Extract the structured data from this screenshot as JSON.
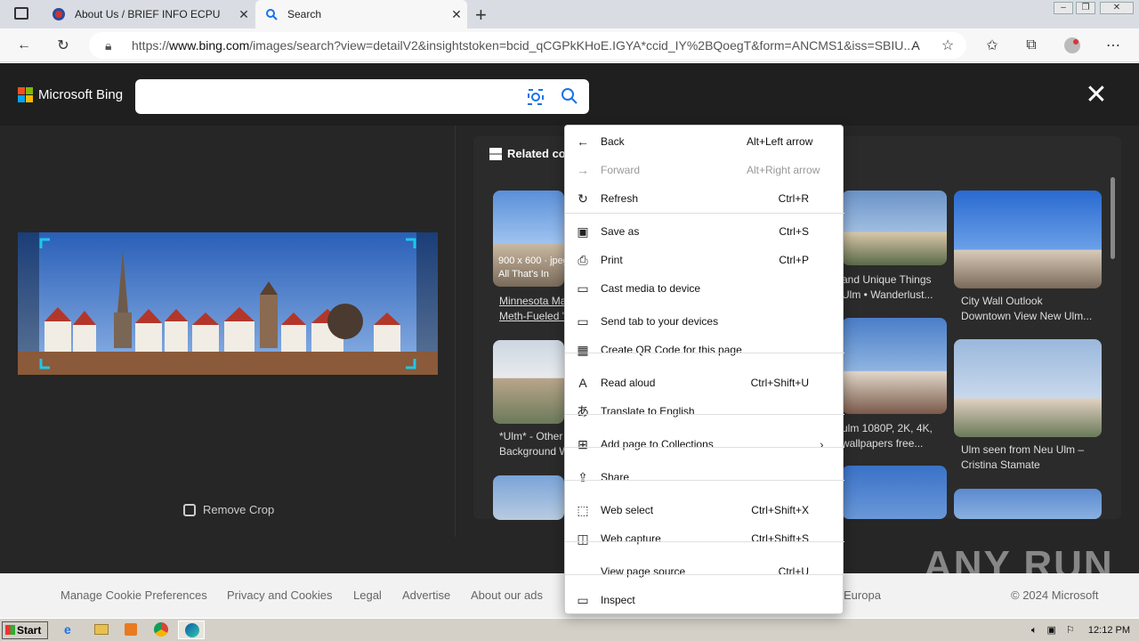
{
  "tabs": [
    {
      "title": "About Us / BRIEF INFO ECPU"
    },
    {
      "title": "Search"
    }
  ],
  "address": {
    "prefix": "https://",
    "host": "www.bing.com",
    "path": "/images/search?view=detailV2&insightstoken=bcid_qCGPkKHoE.IGYA*ccid_IY%2BQoegT&form=ANCMS1&iss=SBIU..."
  },
  "bing": {
    "brand": "Microsoft Bing",
    "remove_crop": "Remove Crop",
    "related": "Related co"
  },
  "results": [
    {
      "caption": "Minnesota Ma\nMeth-Fueled '"
    },
    {
      "caption": "and Unique Things\nUlm • Wanderlust..."
    },
    {
      "caption": "City Wall Outlook\nDowntown View New Ulm..."
    },
    {
      "caption": "*Ulm* - Other\nBackground W"
    },
    {
      "caption": "ulm 1080P, 2K, 4K,\nwallpapers free..."
    },
    {
      "caption": "Ulm seen from Neu Ulm –\nCristina Stamate"
    }
  ],
  "thumb_overlay": "900 x 600 · jpeg\nAll That's In",
  "footer": {
    "items": [
      "Manage Cookie Preferences",
      "Privacy and Cookies",
      "Legal",
      "Advertise",
      "About our ads",
      "Europa",
      "© 2024 Microsoft"
    ]
  },
  "menu": {
    "items": [
      {
        "label": "Back",
        "shortcut": "Alt+Left arrow",
        "icon": "back-arrow-icon",
        "disabled": false
      },
      {
        "label": "Forward",
        "shortcut": "Alt+Right arrow",
        "icon": "forward-arrow-icon",
        "disabled": true
      },
      {
        "label": "Refresh",
        "shortcut": "Ctrl+R",
        "icon": "refresh-icon",
        "disabled": false
      },
      {
        "label": "Save as",
        "shortcut": "Ctrl+S",
        "icon": "save-icon",
        "disabled": false
      },
      {
        "label": "Print",
        "shortcut": "Ctrl+P",
        "icon": "print-icon",
        "disabled": false
      },
      {
        "label": "Cast media to device",
        "shortcut": "",
        "icon": "cast-icon",
        "disabled": false
      },
      {
        "label": "Send tab to your devices",
        "shortcut": "",
        "icon": "send-tab-icon",
        "disabled": false
      },
      {
        "label": "Create QR Code for this page",
        "shortcut": "",
        "icon": "qr-code-icon",
        "disabled": false
      },
      {
        "label": "Read aloud",
        "shortcut": "Ctrl+Shift+U",
        "icon": "read-aloud-icon",
        "disabled": false
      },
      {
        "label": "Translate to English",
        "shortcut": "",
        "icon": "translate-icon",
        "disabled": false
      },
      {
        "label": "Add page to Collections",
        "shortcut": "",
        "icon": "collections-icon",
        "disabled": false
      },
      {
        "label": "Share",
        "shortcut": "",
        "icon": "share-icon",
        "disabled": false
      },
      {
        "label": "Web select",
        "shortcut": "Ctrl+Shift+X",
        "icon": "web-select-icon",
        "disabled": false
      },
      {
        "label": "Web capture",
        "shortcut": "Ctrl+Shift+S",
        "icon": "web-capture-icon",
        "disabled": false
      },
      {
        "label": "View page source",
        "shortcut": "Ctrl+U",
        "icon": "",
        "disabled": false
      },
      {
        "label": "Inspect",
        "shortcut": "",
        "icon": "inspect-icon",
        "disabled": false
      }
    ]
  },
  "taskbar": {
    "start": "Start",
    "time": "12:12 PM"
  },
  "watermark": "ANY RUN"
}
